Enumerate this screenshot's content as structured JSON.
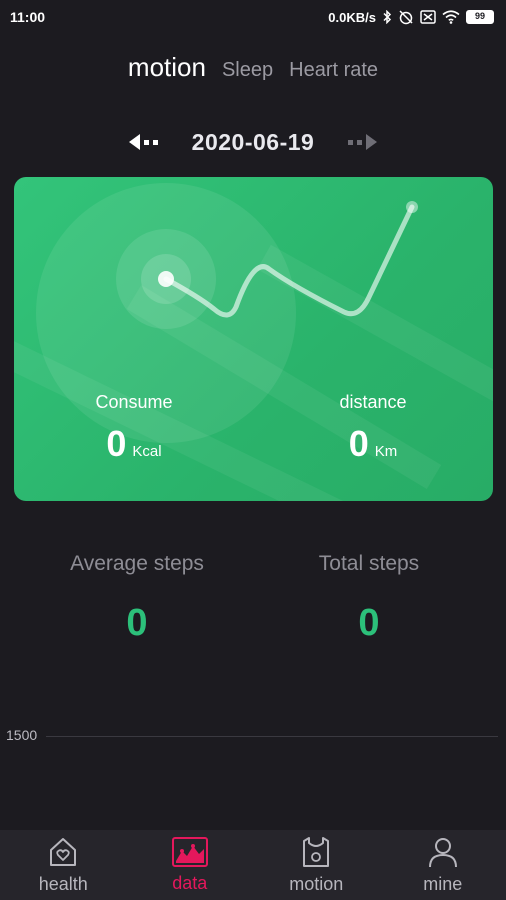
{
  "status_bar": {
    "time": "11:00",
    "network_speed": "0.0KB/s",
    "battery": "99",
    "icons": [
      "bluetooth-icon",
      "alarm-off-icon",
      "sim-icon",
      "wifi-icon",
      "battery-icon"
    ]
  },
  "tabs": [
    {
      "label": "motion",
      "active": true
    },
    {
      "label": "Sleep",
      "active": false
    },
    {
      "label": "Heart rate",
      "active": false
    }
  ],
  "date_nav": {
    "date": "2020-06-19"
  },
  "card": {
    "color": "#2fbd73",
    "consume": {
      "label": "Consume",
      "value": "0",
      "unit": "Kcal"
    },
    "distance": {
      "label": "distance",
      "value": "0",
      "unit": "Km"
    }
  },
  "steps": {
    "average": {
      "label": "Average steps",
      "value": "0"
    },
    "total": {
      "label": "Total steps",
      "value": "0"
    }
  },
  "chart": {
    "axis_label": "1500"
  },
  "bottom_nav": [
    {
      "label": "health",
      "icon": "heart-house-icon",
      "active": false
    },
    {
      "label": "data",
      "icon": "chart-picture-icon",
      "active": true
    },
    {
      "label": "motion",
      "icon": "jersey-icon",
      "active": false
    },
    {
      "label": "mine",
      "icon": "person-icon",
      "active": false
    }
  ],
  "accent_color": "#e4185c",
  "steps_color": "#2cc07a"
}
